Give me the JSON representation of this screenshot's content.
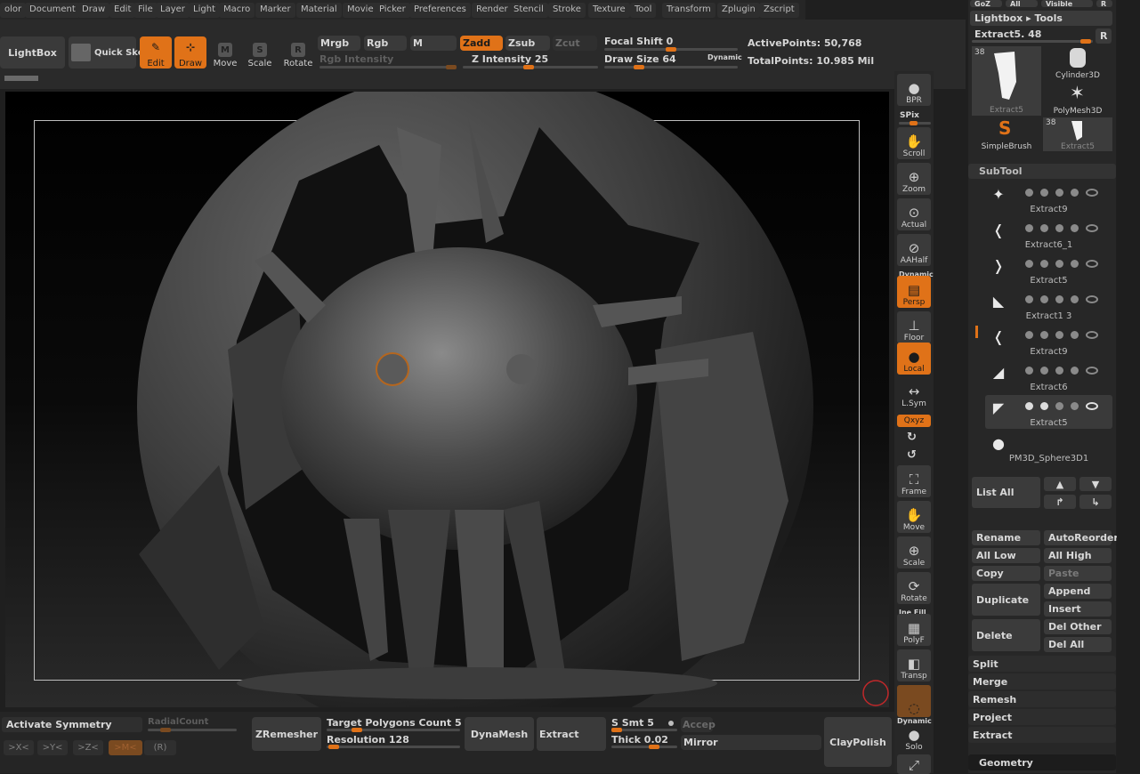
{
  "menu": [
    "olor",
    "Document",
    "Draw",
    "Edit",
    "File",
    "Layer",
    "Light",
    "Macro",
    "Marker",
    "Material",
    "Movie",
    "Picker",
    "Preferences",
    "Render",
    "Stencil",
    "Stroke",
    "Texture",
    "Tool",
    "Transform",
    "Zplugin",
    "Zscript"
  ],
  "toolbar": {
    "lightbox": "LightBox",
    "quick_sketch": "Quick Sketch",
    "edit": "Edit",
    "draw": "Draw",
    "move": "Move",
    "scale": "Scale",
    "rotate": "Rotate",
    "mrgb": "Mrgb",
    "rgb": "Rgb",
    "m": "M",
    "rgb_intensity": "Rgb Intensity",
    "zadd": "Zadd",
    "zsub": "Zsub",
    "zcut": "Zcut",
    "z_intensity_label": "Z Intensity",
    "z_intensity_value": "25",
    "focal_shift_label": "Focal Shift",
    "focal_shift_value": "0",
    "draw_size_label": "Draw Size",
    "draw_size_value": "64",
    "dynamic": "Dynamic",
    "active_points_label": "ActivePoints:",
    "active_points_value": "50,768",
    "total_points_label": "TotalPoints:",
    "total_points_value": "10.985 Mil"
  },
  "right_shelf": [
    "BPR",
    "SPix",
    "Scroll",
    "Zoom",
    "Actual",
    "AAHalf",
    "Persp",
    "Floor",
    "Local",
    "L.Sym",
    "Frame",
    "Move",
    "Scale",
    "Rotate",
    "PolyF",
    "Transp",
    "Solo"
  ],
  "right_shelf_extra": {
    "dynamic": "Dynamic",
    "xyz": "Qxyz",
    "line_fill": "Ine Fill",
    "dynamic2": "Dynamic"
  },
  "tool_panel": {
    "top_buttons": [
      "GoZ",
      "All",
      "Visible",
      "R"
    ],
    "lightbox_tools": "Lightbox ▸ Tools",
    "current_tool": "Extract5. 48",
    "r_button": "R",
    "thumbs": [
      {
        "label": "Extract5",
        "badge": "38"
      },
      {
        "label": "Cylinder3D"
      },
      {
        "label": "PolyMesh3D"
      },
      {
        "label": "SimpleBrush"
      },
      {
        "label": "Extract5",
        "badge": "38"
      }
    ]
  },
  "subtool": {
    "header": "SubTool",
    "items": [
      "Extract9",
      "Extract6_1",
      "Extract5",
      "Extract1 3",
      "Extract9",
      "Extract6",
      "Extract5",
      "PM3D_Sphere3D1"
    ],
    "list_all": "List All",
    "buttons": {
      "rename": "Rename",
      "autoreorder": "AutoReorder",
      "all_low": "All Low",
      "all_high": "All High",
      "copy": "Copy",
      "paste": "Paste",
      "duplicate": "Duplicate",
      "append": "Append",
      "insert": "Insert",
      "delete": "Delete",
      "del_other": "Del Other",
      "del_all": "Del All"
    },
    "sections": [
      "Split",
      "Merge",
      "Remesh",
      "Project",
      "Extract"
    ],
    "geometry": "Geometry"
  },
  "bottom": {
    "activate_symmetry": "Activate Symmetry",
    "radial_count": "RadialCount",
    "sym_x": ">X<",
    "sym_y": ">Y<",
    "sym_z": ">Z<",
    "sym_m": ">M<",
    "sym_r": "(R)",
    "zremesher": "ZRemesher",
    "target_polygons_label": "Target Polygons Count",
    "target_polygons_value": "5",
    "resolution_label": "Resolution",
    "resolution_value": "128",
    "dynamesh": "DynaMesh",
    "extract": "Extract",
    "s_smt_label": "S Smt",
    "s_smt_value": "5",
    "accept": "Accep",
    "thick_label": "Thick",
    "thick_value": "0.02",
    "mirror": "Mirror",
    "claypolish": "ClayPolish"
  },
  "colors": {
    "accent": "#e07218",
    "panel": "#272727",
    "button": "#3a3a3a"
  }
}
